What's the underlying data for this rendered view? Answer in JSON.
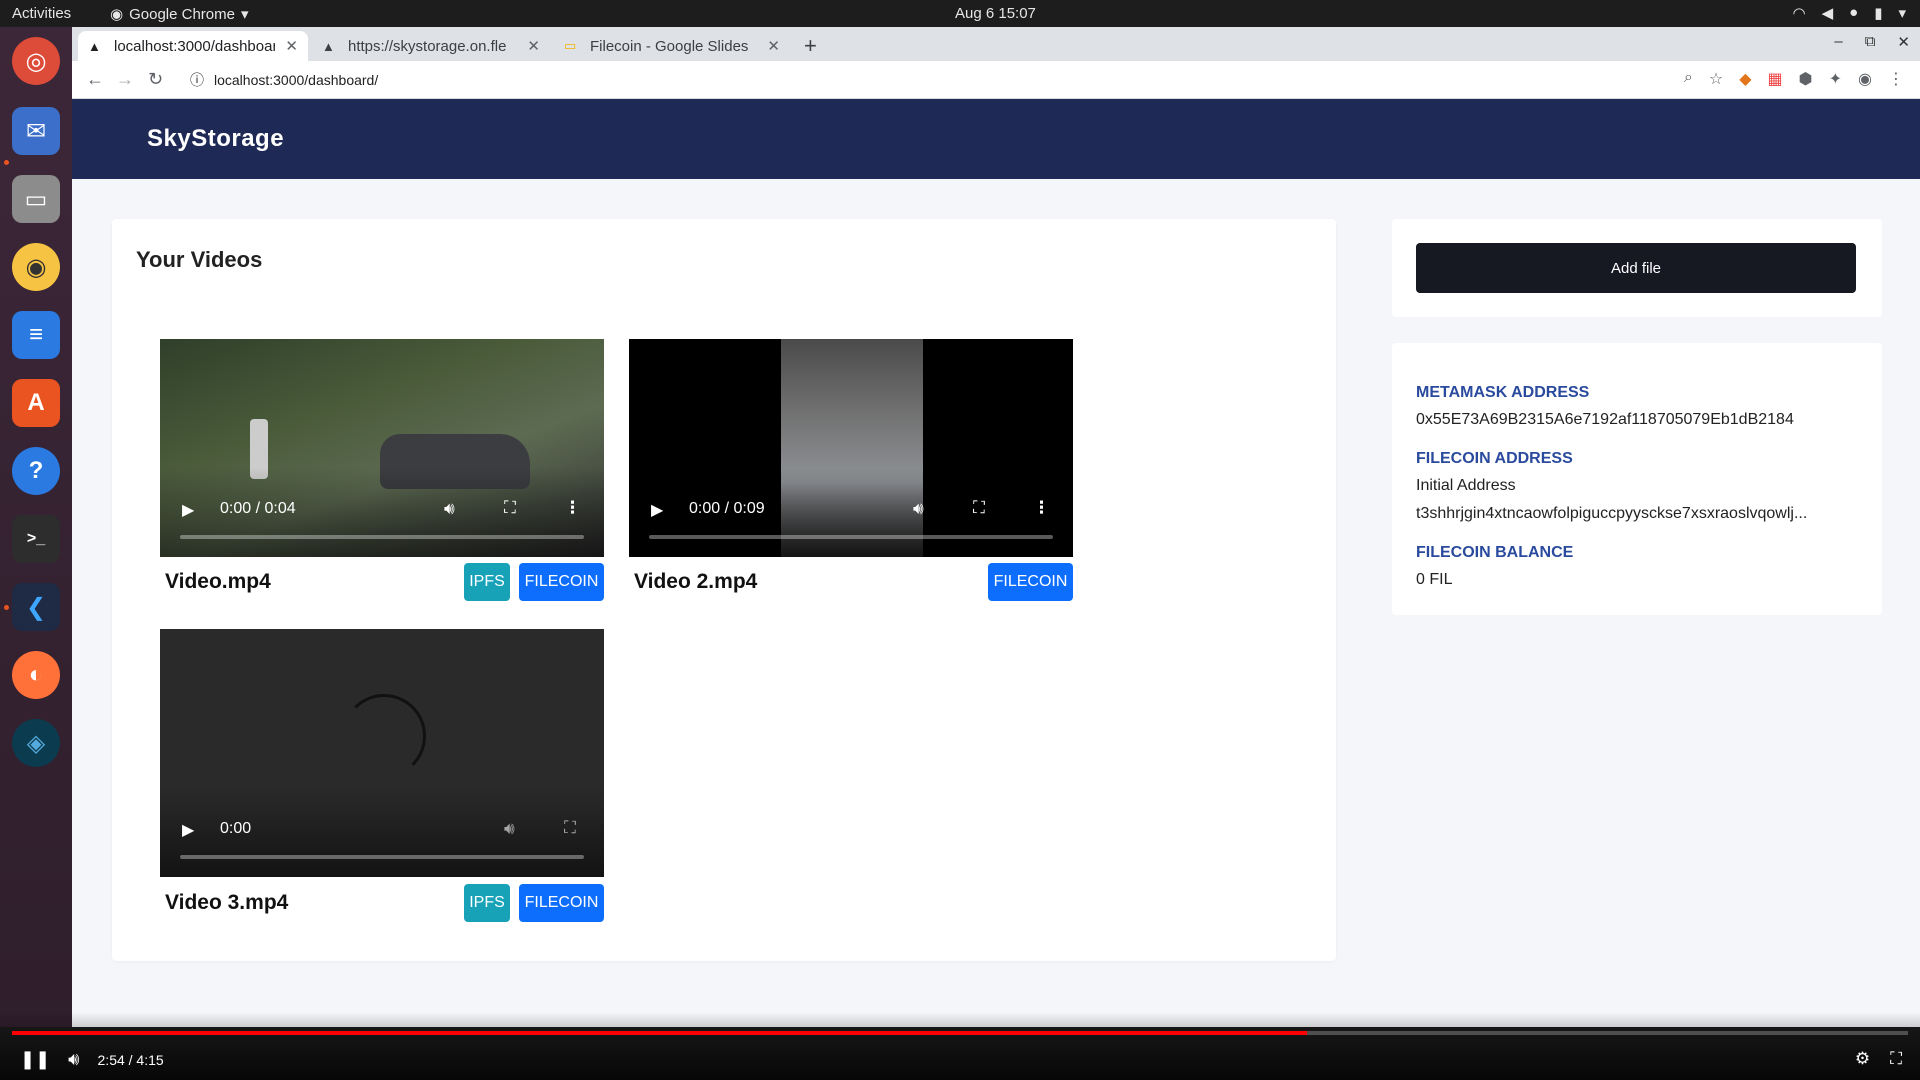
{
  "os": {
    "activities": "Activities",
    "app_name": "Google Chrome",
    "clock": "Aug 6  15:07"
  },
  "browser": {
    "tabs": [
      {
        "title": "localhost:3000/dashboard",
        "active": true
      },
      {
        "title": "https://skystorage.on.fle",
        "active": false
      },
      {
        "title": "Filecoin - Google Slides",
        "active": false
      }
    ],
    "url": "localhost:3000/dashboard/"
  },
  "app": {
    "brand": "SkyStorage",
    "videos_title": "Your Videos",
    "videos": [
      {
        "name": "Video.mp4",
        "time": "0:00 / 0:04",
        "buttons": [
          "IPFS",
          "FILECOIN"
        ]
      },
      {
        "name": "Video 2.mp4",
        "time": "0:00 / 0:09",
        "buttons": [
          "FILECOIN"
        ]
      },
      {
        "name": "Video 3.mp4",
        "time": "0:00",
        "buttons": [
          "IPFS",
          "FILECOIN"
        ]
      }
    ],
    "add_file_label": "Add file",
    "info": {
      "metamask_label": "METAMASK ADDRESS",
      "metamask_value": "0x55E73A69B2315A6e7192af118705079Eb1dB2184",
      "filecoin_label": "FILECOIN ADDRESS",
      "filecoin_initial": "Initial Address",
      "filecoin_value": "t3shhrjgin4xtncaowfolpiguccpyysckse7xsxraoslvqowlj...",
      "balance_label": "FILECOIN BALANCE",
      "balance_value": "0 FIL"
    }
  },
  "player": {
    "time": "2:54 / 4:15",
    "progress": 0.683
  }
}
